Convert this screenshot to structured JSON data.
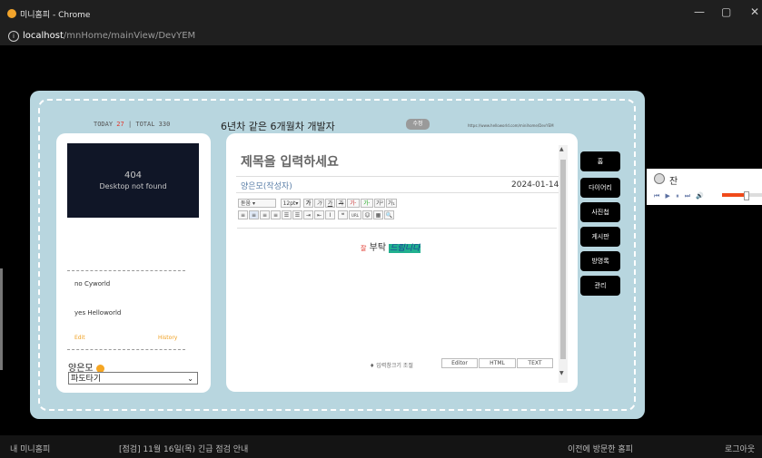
{
  "browser": {
    "window_title": "미니홈피 - Chrome",
    "url_host": "localhost",
    "url_path": "/mnHome/mainView/DevYEM",
    "controls": [
      "—",
      "▢",
      "✕"
    ]
  },
  "header": {
    "today_label": "TODAY",
    "today_count": "27",
    "total_label": "| TOTAL 330",
    "title": "6년차 같은 6개월차 개발자",
    "edit_label": "수정",
    "homepage_url": "https://www.helloworld.com/minihome/DevYEM"
  },
  "profile": {
    "image_code": "404",
    "image_message": "Desktop not found",
    "lines": [
      "no Cyworld",
      "yes Helloworld"
    ],
    "edit_label": "Edit",
    "history_label": "History",
    "name": "양은모",
    "select_value": "파도타기"
  },
  "post": {
    "title_placeholder": "제목을 입력하세요",
    "author": "양은모(작성자)",
    "date": "2024-01-14",
    "body_small": "잘",
    "body_plain": "부탁",
    "body_highlight": "드립니다",
    "resize_label": "♦ 입력창크기 조절",
    "modes": [
      "Editor",
      "HTML",
      "TEXT"
    ]
  },
  "toolbar": {
    "font": "돋움",
    "size": "12pt",
    "row1": [
      "가",
      "가",
      "가",
      "가",
      "가·",
      "가·",
      "가²",
      "가₁"
    ],
    "row2": [
      "≡",
      "≡",
      "≡",
      "≡",
      "☰",
      "☰",
      "⇥",
      "⇤",
      "I",
      "❝",
      "URL",
      "☺",
      "▦",
      "🔍"
    ]
  },
  "nav": {
    "items": [
      "홈",
      "다이어리",
      "사진첩",
      "게시판",
      "방명록",
      "관리"
    ]
  },
  "bgm": {
    "song": "잔",
    "controls": "⏮ ▶ ⏸ ⏭  🔊",
    "volume_fraction": 0.6
  },
  "bottom": {
    "home": "내 미니홈피",
    "notice": "[점검] 11월 16일(목) 긴급 점검 안내",
    "visited": "이전에 방문한 홈피",
    "logout": "로그아웃"
  }
}
